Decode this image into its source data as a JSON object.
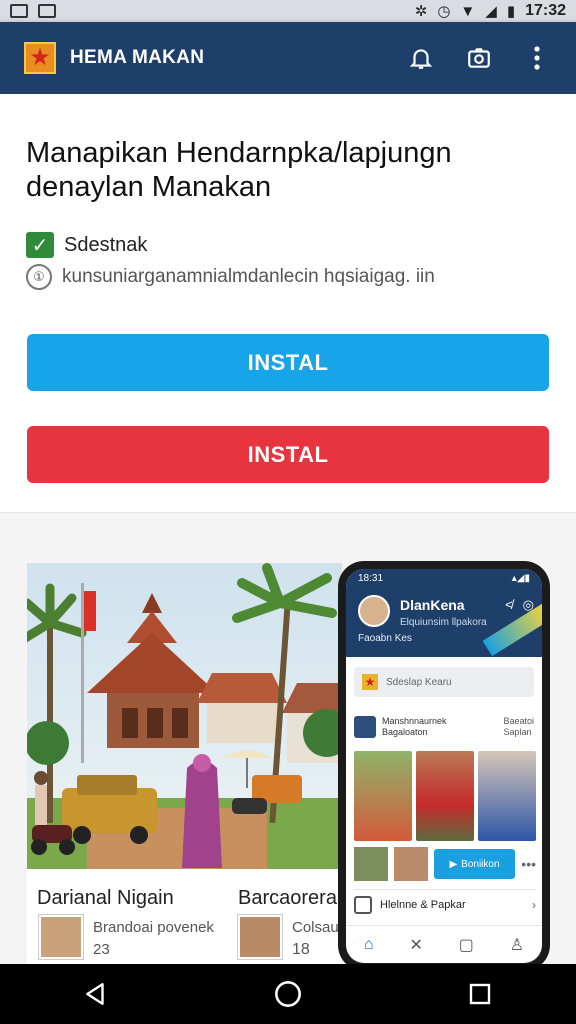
{
  "status_bar": {
    "time": "17:32",
    "icons": [
      "image-icon",
      "mail-icon",
      "gear-icon",
      "alarm-icon",
      "wifi-icon",
      "signal-icon",
      "battery-icon"
    ]
  },
  "app_bar": {
    "title": "HEMA MAKAN",
    "actions": [
      "bell-icon",
      "camera-icon",
      "more-vert-icon"
    ]
  },
  "intro": {
    "title": "Manapikan Hendarnpka/lapjungn denaylan Manakan",
    "checkbox_label": "Sdestnak",
    "info_text": "kunsuniarganamnialmdanlecin hqsiaigag. iin"
  },
  "buttons": {
    "primary_label": "INSTAL",
    "secondary_label": "INSTAL"
  },
  "gallery": {
    "card_a": {
      "title": "Darianal Nigain",
      "subtitle": "Brandoai povenek",
      "count": "23"
    },
    "card_b": {
      "title": "Barcaorera",
      "subtitle": "Colsaua",
      "count": "18"
    }
  },
  "phone": {
    "status_time": "18:31",
    "profile_name": "DlanKena",
    "profile_sub": "Elquiunsim llpakora",
    "header_label": "Faoabn Kes",
    "search_placeholder": "Sdeslap Kearu",
    "post_title": "Manshnnaurnek",
    "post_sub": "Bagaloaton",
    "post_side_a": "Baeatoi",
    "post_side_b": "Saplan",
    "play_label": "Boniikon",
    "list_item": "Hlelnne & Papkar"
  },
  "colors": {
    "app_bar": "#1f3f6b",
    "primary_button": "#18a4e8",
    "secondary_button": "#e8343e",
    "checkbox": "#2f8a3a"
  }
}
